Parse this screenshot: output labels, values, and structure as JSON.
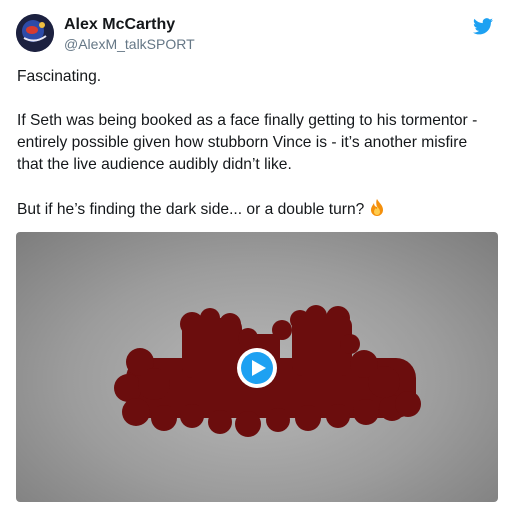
{
  "author": {
    "name": "Alex McCarthy",
    "handle": "@AlexM_talkSPORT"
  },
  "tweet": {
    "para1": "Fascinating.",
    "para2": "If Seth was being booked as a face finally getting to his tormentor - entirely possible given how stubborn Vince is - it’s another misfire that the live audience audibly didn’t like.",
    "para3": "But if he’s finding the dark side... or a double turn?",
    "emoji": "fire-emoji"
  },
  "media": {
    "type": "video",
    "play_icon": "play-icon"
  },
  "icons": {
    "brand": "twitter-bird-icon",
    "brand_color": "#1da1f2"
  },
  "colors": {
    "text": "#14171a",
    "secondary": "#657786",
    "blob": "#6b0d0d"
  }
}
